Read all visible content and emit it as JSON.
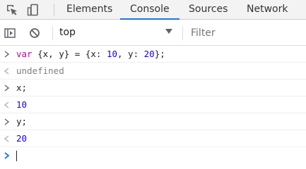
{
  "toolbar": {
    "tabs": [
      "Elements",
      "Console",
      "Sources",
      "Network"
    ],
    "active_tab": "Console",
    "icons": [
      "inspect-element-icon",
      "device-toolbar-icon"
    ]
  },
  "filterbar": {
    "context": "top",
    "filter_placeholder": "Filter",
    "icons": [
      "sidebar-toggle-icon",
      "clear-console-icon",
      "chevron-down-icon"
    ]
  },
  "console": {
    "entry1": {
      "kw": "var",
      "p1": " {x, y} = {x: ",
      "n1": "10",
      "p2": ", y: ",
      "n2": "20",
      "p3": "};"
    },
    "result1": "undefined",
    "entry2": "x;",
    "result2": "10",
    "entry3": "y;",
    "result3": "20"
  },
  "colors": {
    "accent": "#1a73e8",
    "keyword": "#aa0d91",
    "number": "#1c00cf",
    "prompt": "#1a73e8"
  }
}
